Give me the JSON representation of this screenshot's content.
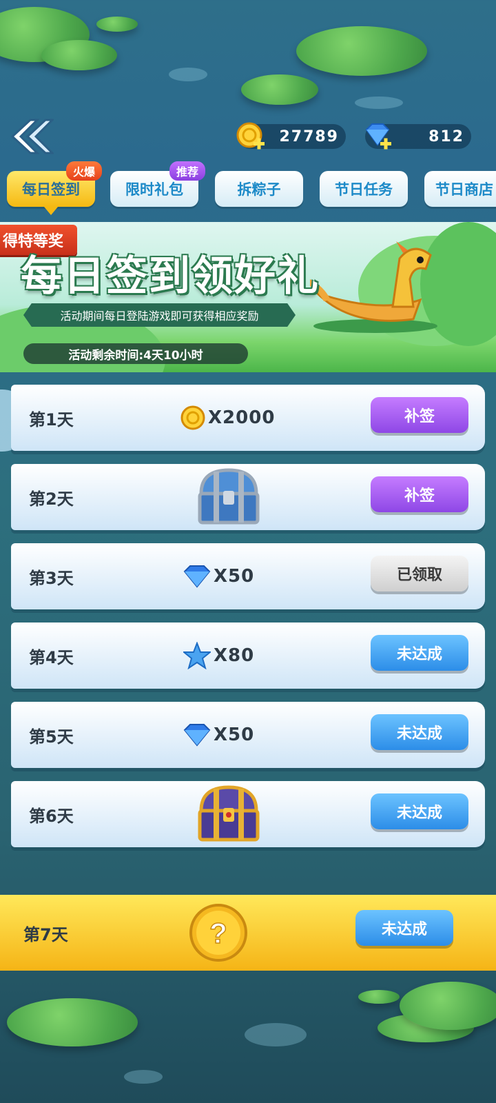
{
  "header": {
    "coins": "27789",
    "gems": "812"
  },
  "tabs": [
    {
      "label": "每日签到",
      "tag": "火爆"
    },
    {
      "label": "限时礼包",
      "tag": "推荐"
    },
    {
      "label": "拆粽子"
    },
    {
      "label": "节日任务"
    },
    {
      "label": "节日商店"
    }
  ],
  "banner": {
    "ribbon": "得特等奖",
    "title": "每日签到领好礼",
    "subtitle": "活动期间每日登陆游戏即可获得相应奖励",
    "timer": "活动剩余时间:4天10小时"
  },
  "days": [
    {
      "label": "第1天",
      "reward_icon": "coin-icon",
      "qty": "X2000",
      "button": "补签"
    },
    {
      "label": "第2天",
      "reward_icon": "silver-chest-icon",
      "qty": "",
      "button": "补签"
    },
    {
      "label": "第3天",
      "reward_icon": "diamond-icon",
      "qty": "X50",
      "button": "已领取"
    },
    {
      "label": "第4天",
      "reward_icon": "star-icon",
      "qty": "X80",
      "button": "未达成"
    },
    {
      "label": "第5天",
      "reward_icon": "diamond-icon",
      "qty": "X50",
      "button": "未达成"
    },
    {
      "label": "第6天",
      "reward_icon": "gold-chest-icon",
      "qty": "",
      "button": "未达成"
    },
    {
      "label": "第7天",
      "reward_icon": "mystery-coin-icon",
      "qty": "",
      "button": "未达成"
    }
  ],
  "colors": {
    "purple_button": "#8e47e6",
    "blue_button": "#2c8de8",
    "gray_button": "#cfcfcf",
    "active_tab": "#f5b912"
  }
}
